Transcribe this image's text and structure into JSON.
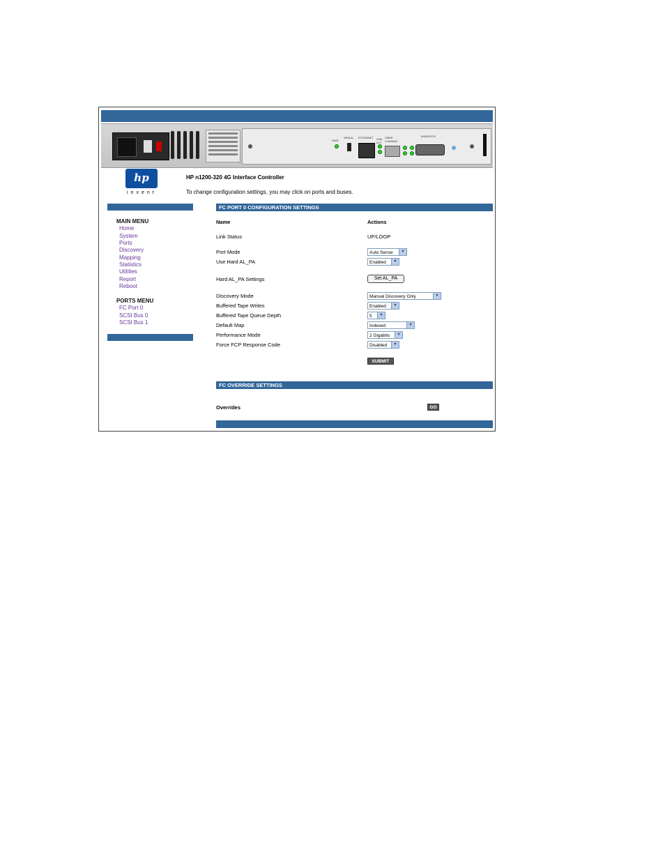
{
  "header": {
    "logo_text": "hp",
    "logo_tagline": "invent",
    "title": "HP n1200-320 4G Interface Controller",
    "description": "To change configuration settings, you may click on ports and buses."
  },
  "chassis": {
    "labels": [
      "PWR",
      "SERIAL",
      "ETHERNET",
      "LINK ACT",
      "FIBRE CHANNEL",
      "WIDE/SCSI"
    ]
  },
  "main_menu": {
    "heading": "MAIN MENU",
    "items": [
      "Home",
      "System",
      "Ports",
      "Discovery",
      "Mapping",
      "Statistics",
      "Utilities",
      "Report",
      "Reboot"
    ]
  },
  "ports_menu": {
    "heading": "PORTS MENU",
    "items": [
      "FC Port 0",
      "SCSI Bus 0",
      "SCSI Bus 1"
    ]
  },
  "config": {
    "section_title": "FC PORT 0 CONFIGURATION SETTINGS",
    "col_name": "Name",
    "col_actions": "Actions",
    "link_status_label": "Link Status",
    "link_status_value": "UP/LOOP",
    "port_mode_label": "Port Mode",
    "port_mode_value": "Auto Sense",
    "hard_alpa_label": "Use Hard AL_PA",
    "hard_alpa_value": "Enabled",
    "hard_alpa_settings_label": "Hard AL_PA Settings",
    "set_alpa_button": "Set AL_PA",
    "discovery_mode_label": "Discovery Mode",
    "discovery_mode_value": "Manual Discovery Only",
    "buffered_writes_label": "Buffered Tape Writes",
    "buffered_writes_value": "Enabled",
    "queue_depth_label": "Buffered Tape Queue Depth",
    "queue_depth_value": "5",
    "default_map_label": "Default Map",
    "default_map_value": "Indexed",
    "performance_label": "Performance Mode",
    "performance_value": "2 Gigabits",
    "force_fcp_label": "Force FCP Response Code",
    "force_fcp_value": "Disabled",
    "submit_button": "SUBMIT"
  },
  "override": {
    "section_title": "FC OVERRIDE SETTINGS",
    "label": "Overrides",
    "go_button": "GO"
  },
  "colors": {
    "bar": "#336699",
    "link": "#663399"
  }
}
